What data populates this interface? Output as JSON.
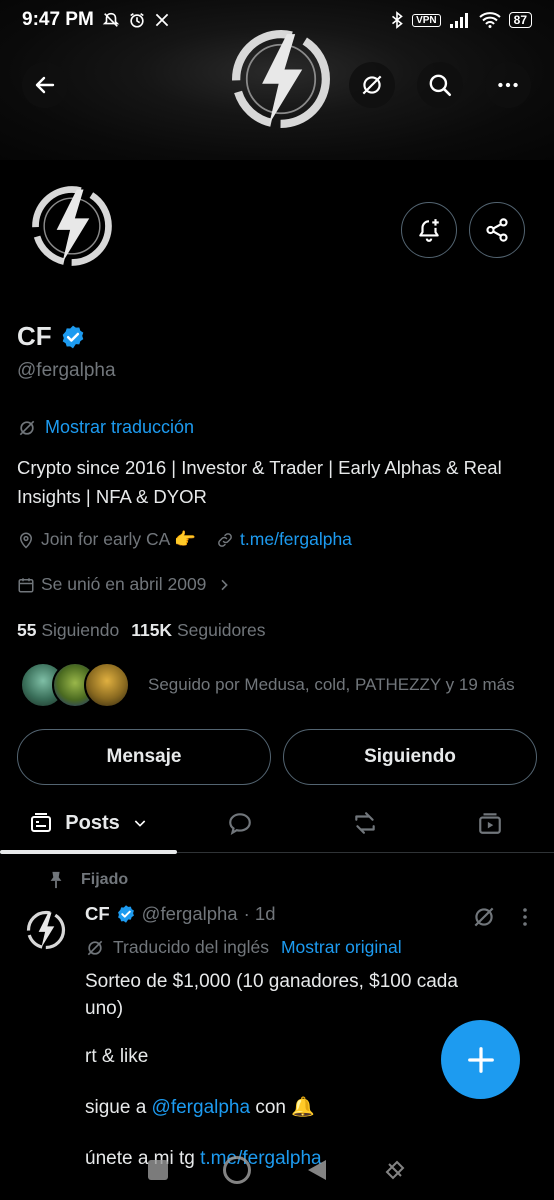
{
  "status_bar": {
    "time": "9:47 PM",
    "vpn": "VPN",
    "battery": "87"
  },
  "header": {
    "back_icon": "arrow-left-icon",
    "translate_icon": "translate-icon",
    "search_icon": "search-icon",
    "more_icon": "more-horizontal-icon"
  },
  "profile": {
    "name": "CF",
    "handle": "@fergalpha",
    "show_translation": "Mostrar traducción",
    "bio_line1": "Crypto since 2016 | Investor & Trader | Early Alphas & Real",
    "bio_line2": "Insights | NFA & DYOR",
    "location": "Join for early CA 👉",
    "website": "t.me/fergalpha",
    "joined": "Se unió en abril 2009",
    "following_count": "55",
    "following_label": "Siguiendo",
    "followers_count": "115K",
    "followers_label": "Seguidores",
    "followed_by": "Seguido por Medusa, cold, PATHEZZY y 19 más"
  },
  "actions": {
    "message": "Mensaje",
    "following": "Siguiendo"
  },
  "tabs": {
    "posts": "Posts"
  },
  "post": {
    "pinned_label": "Fijado",
    "author_name": "CF",
    "author_handle": "@fergalpha",
    "time": "· 1d",
    "translated_from": "Traducido del inglés",
    "show_original": "Mostrar original",
    "line1": "Sorteo de $1,000 (10 ganadores, $100 cada",
    "line2": "uno)",
    "line3": "rt & like",
    "line4_prefix": "sigue a ",
    "line4_link": "@fergalpha",
    "line4_suffix": " con 🔔",
    "line5_prefix": "únete a mi tg ",
    "line5_link": "t.me/fergalpha"
  },
  "colors": {
    "accent": "#1d9bf0",
    "background": "#000000",
    "text": "#e7e9ea",
    "muted": "#71767b",
    "border": "#536471"
  }
}
